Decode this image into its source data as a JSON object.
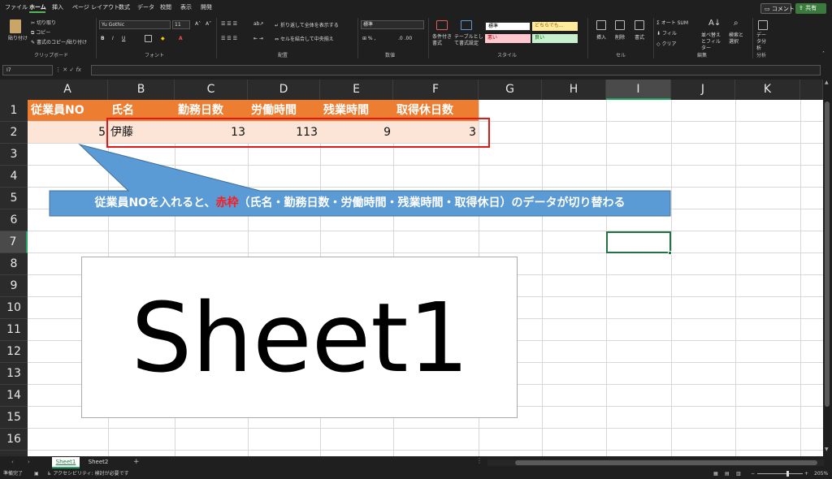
{
  "menu": {
    "tabs": [
      "ファイル",
      "ホーム",
      "挿入",
      "ページ レイアウト",
      "数式",
      "データ",
      "校閲",
      "表示",
      "開発"
    ],
    "comments": "コメント",
    "share": "共有"
  },
  "clipboard": {
    "paste": "貼り付け",
    "cut": "切り取り",
    "copy": "コピー",
    "format_painter": "書式のコピー/貼り付け",
    "group": "クリップボード"
  },
  "font": {
    "name": "Yu Gothic",
    "size": "11",
    "bold": "B",
    "italic": "I",
    "underline": "U",
    "group": "フォント"
  },
  "alignment": {
    "wrap": "折り返して全体を表示する",
    "merge": "セルを結合して中央揃え",
    "group": "配置"
  },
  "number": {
    "format": "標準",
    "group": "数値"
  },
  "styles": {
    "conditional": "条件付き書式",
    "table": "テーブルとして書式設定",
    "normal": "標準",
    "neutral": "どちらでも...",
    "bad": "悪い",
    "good": "良い",
    "group": "スタイル"
  },
  "cells": {
    "insert": "挿入",
    "delete": "削除",
    "format": "書式",
    "group": "セル"
  },
  "editing": {
    "autosum": "オート SUM",
    "fill": "フィル",
    "clear": "クリア",
    "sort": "並べ替えとフィルター",
    "find": "検索と選択",
    "group": "編集"
  },
  "analysis": {
    "analyze": "データ分析",
    "group": "分析"
  },
  "formula_bar": {
    "name_box": "I7",
    "fx": "fx",
    "value": ""
  },
  "columns": [
    "A",
    "B",
    "C",
    "D",
    "E",
    "F",
    "G",
    "H",
    "I",
    "J",
    "K"
  ],
  "rows": [
    "1",
    "2",
    "3",
    "4",
    "5",
    "6",
    "7",
    "8",
    "9",
    "10",
    "11",
    "12",
    "13",
    "14",
    "15",
    "16"
  ],
  "table": {
    "headers": [
      "従業員NO",
      "氏名",
      "勤務日数",
      "労働時間",
      "残業時間",
      "取得休日数"
    ],
    "row": {
      "emp_no": "5",
      "name": "伊藤",
      "work_days": "13",
      "work_hours": "113",
      "overtime": "9",
      "holidays": "3"
    }
  },
  "callout": {
    "before": "従業員NOを入れると、",
    "red": "赤枠",
    "after": "（氏名・勤務日数・労働時間・残業時間・取得休日）のデータが切り替わる"
  },
  "sheet_label": "Sheet1",
  "sheet_tabs": [
    "Sheet1",
    "Sheet2"
  ],
  "status": {
    "ready": "準備完了",
    "accessibility": "アクセシビリティ: 検討が必要です",
    "zoom": "205%"
  },
  "colors": {
    "header_fill": "#ed7d31",
    "data_fill": "#fce4d6",
    "callout_fill": "#5b9bd5",
    "red_frame": "#e01818",
    "accent": "#21a366"
  }
}
